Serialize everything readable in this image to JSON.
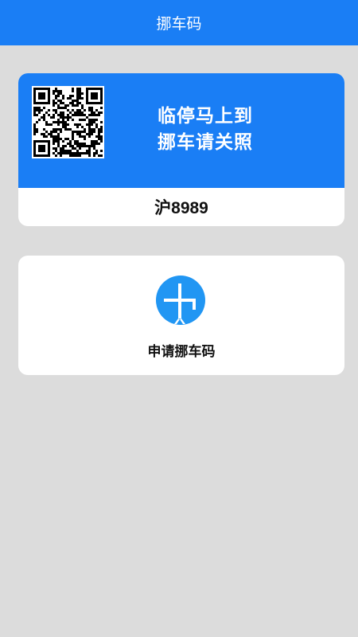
{
  "header": {
    "title": "挪车码"
  },
  "qr_card": {
    "caption_line1": "临停马上到",
    "caption_line2": "挪车请关照",
    "plate_number": "沪8989"
  },
  "apply_card": {
    "label": "申请挪车码",
    "icon": "plus-circle-icon",
    "icon_color": "#2196f3"
  },
  "colors": {
    "brand_blue": "#1a7ef5",
    "background": "#dcdcdc",
    "card": "#ffffff"
  }
}
